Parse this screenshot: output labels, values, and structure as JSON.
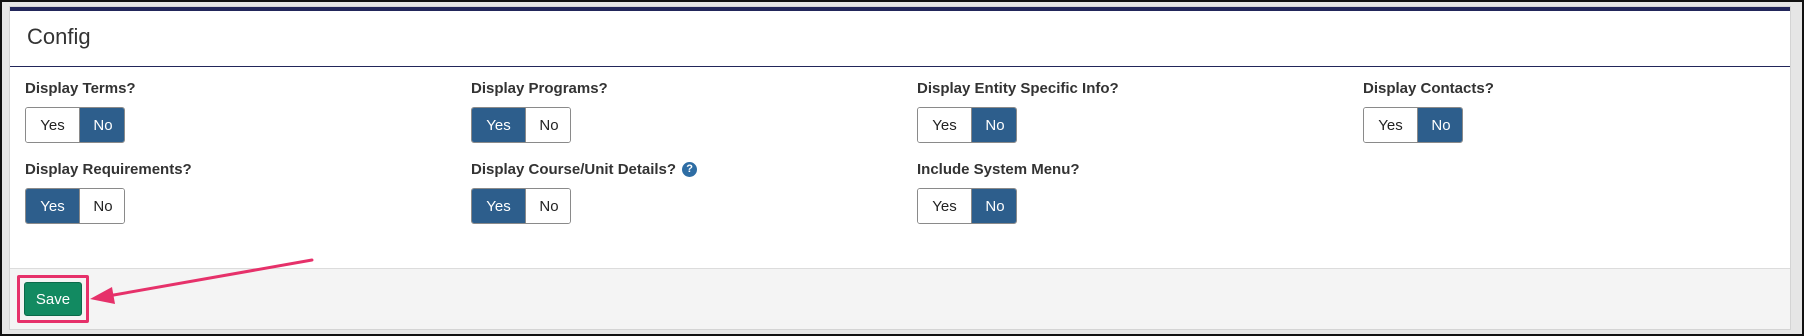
{
  "panel": {
    "title": "Config"
  },
  "fields": [
    {
      "label": "Display Terms?",
      "yes": "Yes",
      "no": "No",
      "selected": "no"
    },
    {
      "label": "Display Programs?",
      "yes": "Yes",
      "no": "No",
      "selected": "yes"
    },
    {
      "label": "Display Entity Specific Info?",
      "yes": "Yes",
      "no": "No",
      "selected": "no"
    },
    {
      "label": "Display Contacts?",
      "yes": "Yes",
      "no": "No",
      "selected": "no"
    },
    {
      "label": "Display Requirements?",
      "yes": "Yes",
      "no": "No",
      "selected": "yes"
    },
    {
      "label": "Display Course/Unit Details?",
      "yes": "Yes",
      "no": "No",
      "selected": "yes",
      "help": "?"
    },
    {
      "label": "Include System Menu?",
      "yes": "Yes",
      "no": "No",
      "selected": "no"
    }
  ],
  "footer": {
    "save_label": "Save"
  },
  "colors": {
    "accent": "#22265a",
    "active_toggle": "#2d5e8c",
    "save": "#128a61",
    "highlight": "#e6316a"
  }
}
